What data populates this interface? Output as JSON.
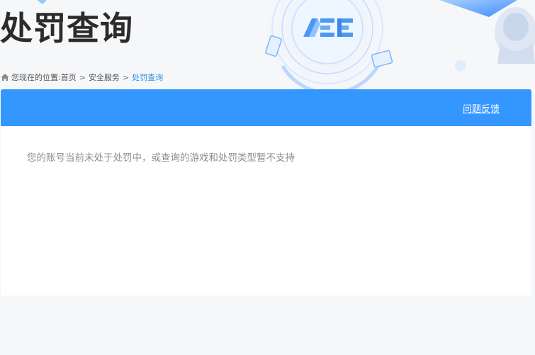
{
  "page": {
    "title": "处罚查询"
  },
  "breadcrumb": {
    "prefix": "您现在的位置:",
    "items": [
      "首页",
      "安全服务",
      "处罚查询"
    ],
    "separator": ">"
  },
  "header": {
    "feedback_label": "问题反馈",
    "color": "#3496ff"
  },
  "result": {
    "message": "您的账号当前未处于处罚中，或查询的游戏和处罚类型暂不支持"
  },
  "icons": {
    "home": "home-icon",
    "logo": "ace-logo-icon"
  },
  "colors": {
    "accent": "#3496ff",
    "breadcrumb_current": "#2b8ce5",
    "title": "#2b2b2b",
    "message": "#8c8c8c"
  }
}
